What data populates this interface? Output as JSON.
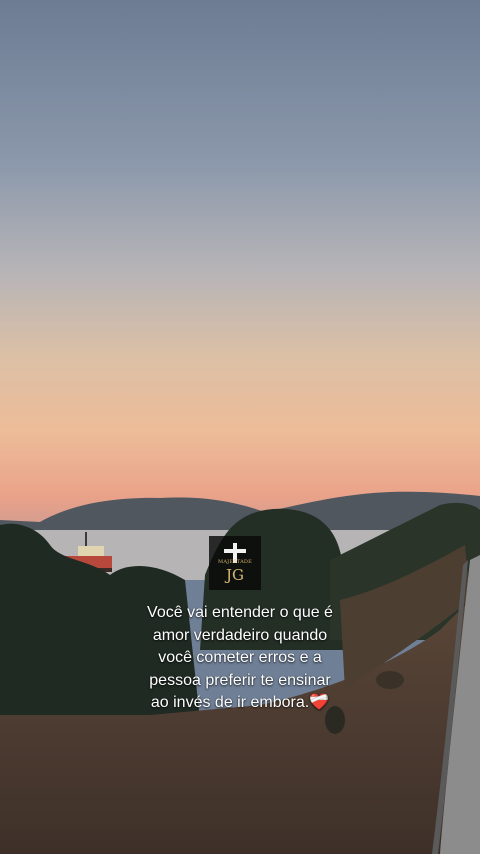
{
  "logo": {
    "small_text": "MAJESTADE",
    "monogram": "JG"
  },
  "caption": {
    "lines": [
      "Você vai entender o que é",
      "amor verdadeiro quando",
      "você cometer erros e a",
      "pessoa preferir te ensinar",
      "ao invés de ir embora.❤️‍🩹"
    ]
  },
  "colors": {
    "sky_top": "#6d7c93",
    "horizon_glow": "#e7a486",
    "ground": "#4a3a30",
    "water": "#b7b4b6"
  }
}
